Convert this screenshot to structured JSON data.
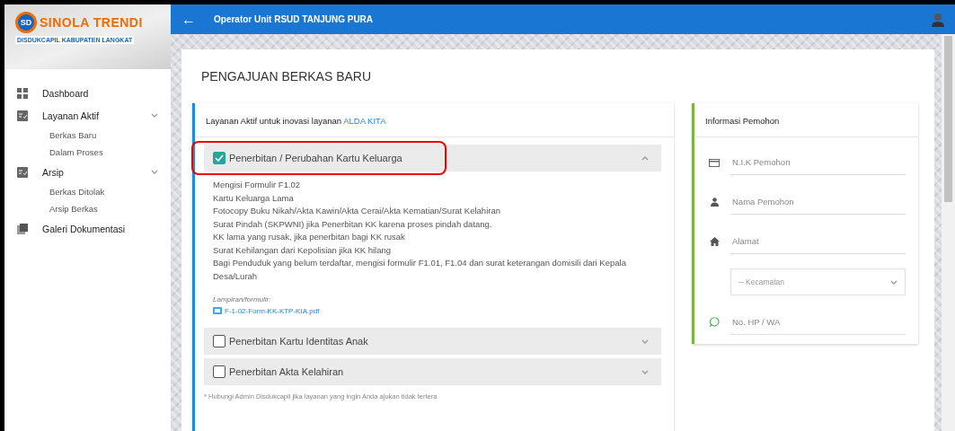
{
  "sidebar": {
    "logo": {
      "mark": "SD",
      "title": "SINOLA TRENDI",
      "subtitle": "DISDUKCAPIL KABUPATEN LANGKAT"
    },
    "items": [
      {
        "label": "Dashboard"
      },
      {
        "label": "Layanan Aktif",
        "children": [
          {
            "label": "Berkas Baru"
          },
          {
            "label": "Dalam Proses"
          }
        ]
      },
      {
        "label": "Arsip",
        "children": [
          {
            "label": "Berkas Ditolak"
          },
          {
            "label": "Arsip Berkas"
          }
        ]
      },
      {
        "label": "Galeri Dokumentasi"
      }
    ]
  },
  "topbar": {
    "back": "←",
    "title": "Operator Unit RSUD TANJUNG PURA"
  },
  "page": {
    "title": "PENGAJUAN BERKAS BARU",
    "services_card": {
      "intro": "Layanan Aktif untuk inovasi layanan",
      "innovation": "ALDA KITA",
      "services": [
        {
          "label": "Penerbitan / Perubahan Kartu Keluarga",
          "checked": true,
          "expanded": true,
          "highlighted": true,
          "requirements": [
            "Mengisi Formulir F1.02",
            "Kartu Keluarga Lama",
            "Fotocopy Buku Nikah/Akta Kawin/Akta Cerai/Akta Kematian/Surat Kelahiran",
            "Surat Pindah (SKPWNI) jika Penerbitan KK karena proses pindah datang.",
            "KK lama yang rusak, jika penerbitan bagi KK rusak",
            "Surat Kehilangan dari Kepolisian jika KK hilang",
            "Bagi Penduduk yang belum terdaftar, mengisi formulir F1.01, F1.04 dan surat keterangan domisili dari Kepala Desa/Lurah"
          ],
          "attachment_label": "Lampiran/formulir:",
          "attachment": "F-1-02-Form-KK-KTP-KIA.pdf"
        },
        {
          "label": "Penerbitan Kartu Identitas Anak",
          "checked": false,
          "expanded": false,
          "highlighted": false
        },
        {
          "label": "Penerbitan Akta Kelahiran",
          "checked": false,
          "expanded": false,
          "highlighted": false
        }
      ],
      "note": "* Hubungi Admin Disdukcapil jika layanan yang ingin Anda ajukan tidak tertera"
    },
    "applicant_card": {
      "title": "Informasi Pemohon",
      "fields": [
        {
          "kind": "input",
          "placeholder": "N.I.K Pemohon"
        },
        {
          "kind": "input",
          "placeholder": "Nama Pemohon"
        },
        {
          "kind": "input",
          "placeholder": "Alamat"
        },
        {
          "kind": "select",
          "placeholder": "-- Kecamatan"
        },
        {
          "kind": "input",
          "placeholder": "No. HP / WA"
        }
      ]
    }
  }
}
